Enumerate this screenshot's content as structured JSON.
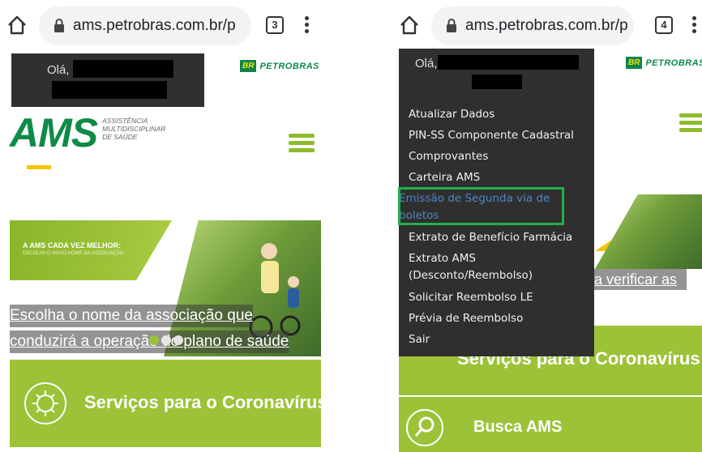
{
  "left_panel": {
    "browser": {
      "url": "ams.petrobras.com.br/p",
      "tab_count": "3"
    },
    "header": {
      "greeting": "Olá,",
      "petrobras_badge": "BR",
      "petrobras_name": "PETROBRAS"
    },
    "logo": {
      "word": "AMS",
      "tagline_1": "ASSISTÊNCIA",
      "tagline_2": "MULTIDISCIPLINAR",
      "tagline_3": "DE SAÚDE"
    },
    "banner": {
      "title": "A AMS CADA VEZ MELHOR:",
      "subtitle": "ESCOLHA O NOVO NOME DA ASSOCIAÇÃO",
      "link_line_1": "Escolha o nome da associação que",
      "link_line_2": "conduzirá a operação do plano de saúde"
    },
    "card": {
      "label": "Serviços para o Coronavírus"
    }
  },
  "right_panel": {
    "browser": {
      "url": "ams.petrobras.com.br/p",
      "tab_count": "4"
    },
    "header": {
      "greeting": "Olá,",
      "petrobras_badge": "BR",
      "petrobras_name": "PETROBRAS"
    },
    "menu": {
      "items": [
        "Atualizar Dados",
        "PIN-SS Componente Cadastral",
        "Comprovantes",
        "Carteira AMS",
        "Emissão de Segunda via de",
        "boletos",
        "Extrato de Benefício Farmácia",
        "Extrato AMS",
        "(Desconto/Reembolso)",
        "Solicitar Reembolso LE",
        "Prévia de Reembolso",
        "Sair"
      ]
    },
    "banner": {
      "link_fragment": "a verificar as"
    },
    "cards": {
      "coronavirus": "Serviços para o Coronavírus",
      "busca": "Busca AMS"
    }
  },
  "colors": {
    "brand_green": "#0f8a48",
    "accent_lime": "#9cc238",
    "menu_bg": "#2f2f2f",
    "highlight_box": "#21b04b",
    "link_blue": "#4c86c6"
  },
  "icons": [
    "home-icon",
    "lock-icon",
    "tabs-icon",
    "kebab-icon",
    "hamburger-icon",
    "virus-icon",
    "search-icon"
  ]
}
